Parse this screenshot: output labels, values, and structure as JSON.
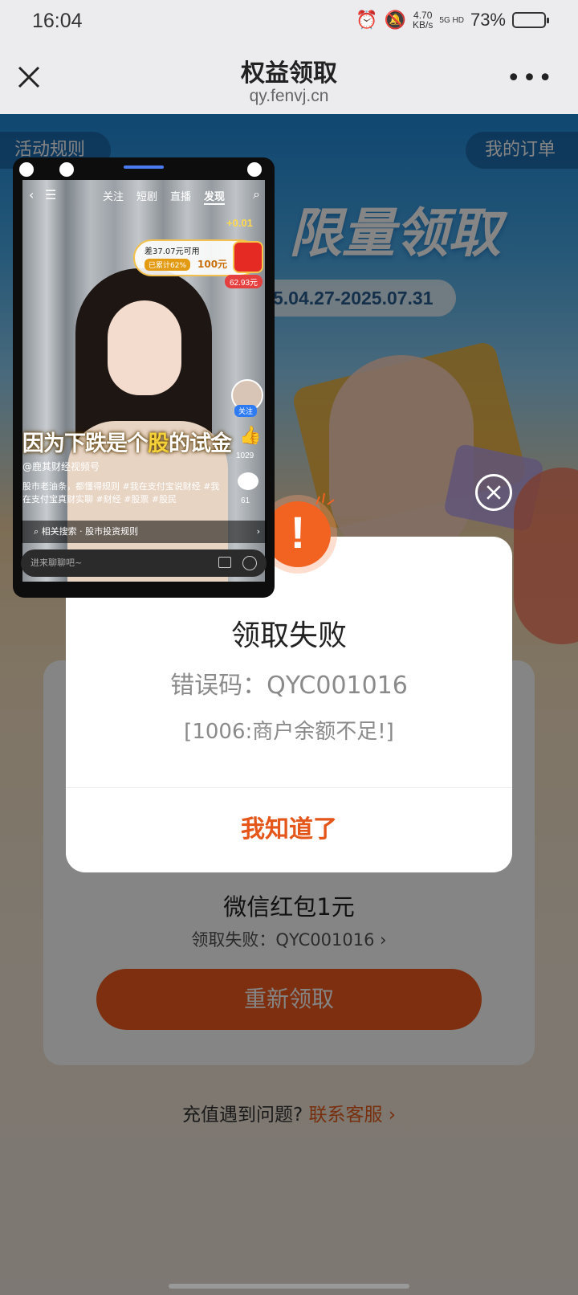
{
  "status_bar": {
    "time": "16:04",
    "net_speed": "4.70",
    "net_unit": "KB/s",
    "signal": "5G HD",
    "battery": "73%",
    "battery_color": "#4fc3f7"
  },
  "nav": {
    "title": "权益领取",
    "url": "qy.fenvj.cn",
    "close_icon": "close-icon",
    "more_icon": "more-icon"
  },
  "banner": {
    "rules_label": "活动规则",
    "orders_label": "我的订单",
    "title": "限量领取",
    "date_range": "5.04.27-2025.07.31"
  },
  "card": {
    "item_title": "微信红包1元",
    "status_text": "领取失败：QYC001016",
    "retry_label": "重新领取"
  },
  "help": {
    "question": "充值遇到问题?",
    "link": "联系客服"
  },
  "modal": {
    "title": "领取失败",
    "error_code": "错误码：QYC001016",
    "detail": "[1006:商户余额不足!]",
    "confirm_label": "我知道了",
    "accent_color": "#e4561a"
  },
  "pip": {
    "tabs": [
      "关注",
      "短剧",
      "直播",
      "发现"
    ],
    "active_tab": "发现",
    "bonus": "+0.01",
    "reward_line1": "差37.07元可用",
    "reward_progress": "已累计62%",
    "reward_amount": "100元",
    "reward_progress_value": 62,
    "badge": "62.93元",
    "follow": "关注",
    "like_count": "1029",
    "comment_count": "61",
    "caption_pre": "因为下跌是个",
    "caption_hl": "股",
    "caption_post": "的试金",
    "author": "@鹿其财经视频号",
    "description": "股市老油条，都懂得规则 #我在支付宝说财经 #我在支付宝真财实聊 #财经 #股票 #股民",
    "related_search": "相关搜索 · 股市投资规则",
    "input_placeholder": "进来聊聊吧~"
  }
}
